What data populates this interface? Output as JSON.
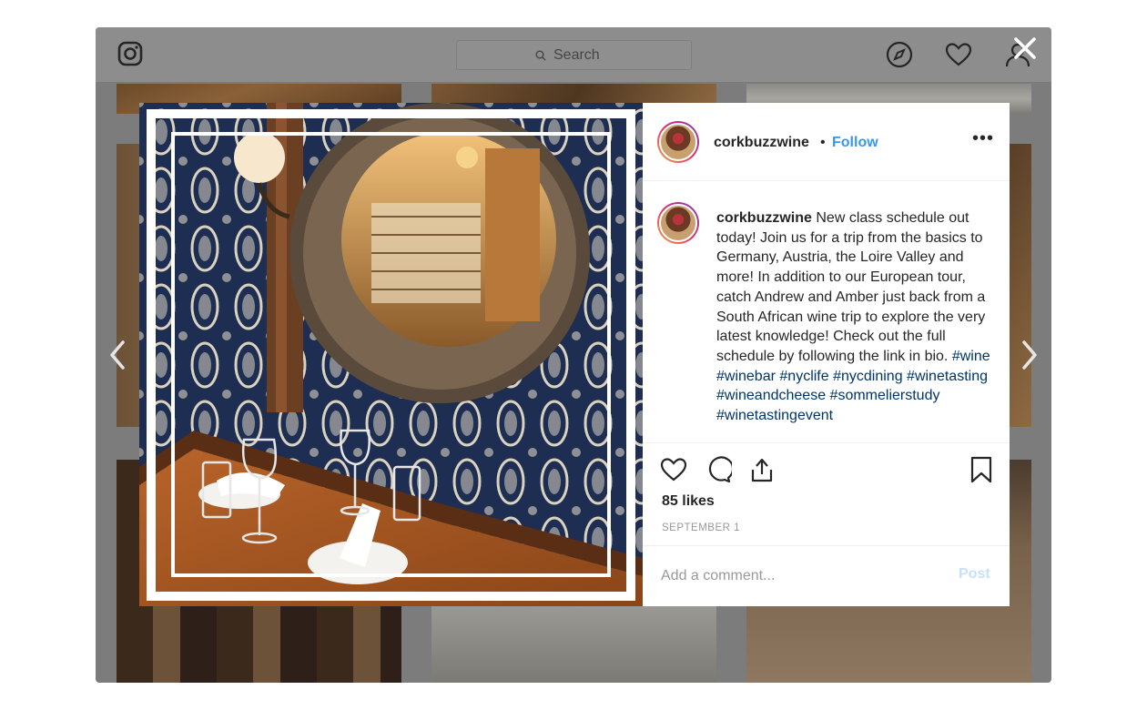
{
  "topbar": {
    "search_placeholder": "Search"
  },
  "post": {
    "username": "corkbuzzwine",
    "separator": "•",
    "follow_label": "Follow",
    "more_label": "•••",
    "caption_text": "New class schedule out today! Join us for a trip from the basics to Germany, Austria, the Loire Valley and more! In addition to our European tour, catch Andrew and Amber just back from a South African wine trip to explore the very latest knowledge! Check out the full schedule by following the link in bio.",
    "hashtags": [
      "#wine",
      "#winebar",
      "#nyclife",
      "#nycdining",
      "#winetasting",
      "#wineandcheese",
      "#sommelierstudy",
      "#winetastingevent"
    ],
    "likes": "85 likes",
    "date": "SEPTEMBER 1",
    "comment_placeholder": "Add a comment...",
    "post_label": "Post"
  },
  "colors": {
    "link_blue": "#3897f0",
    "hashtag_blue": "#003569",
    "post_disabled": "#c7e1fb",
    "overlay": "#7c7c7c"
  },
  "icons": [
    "instagram-icon",
    "search-icon",
    "explore-compass-icon",
    "heart-icon",
    "profile-icon",
    "close-icon",
    "chevron-left-icon",
    "chevron-right-icon",
    "like-heart-icon",
    "comment-icon",
    "share-icon",
    "bookmark-icon"
  ]
}
